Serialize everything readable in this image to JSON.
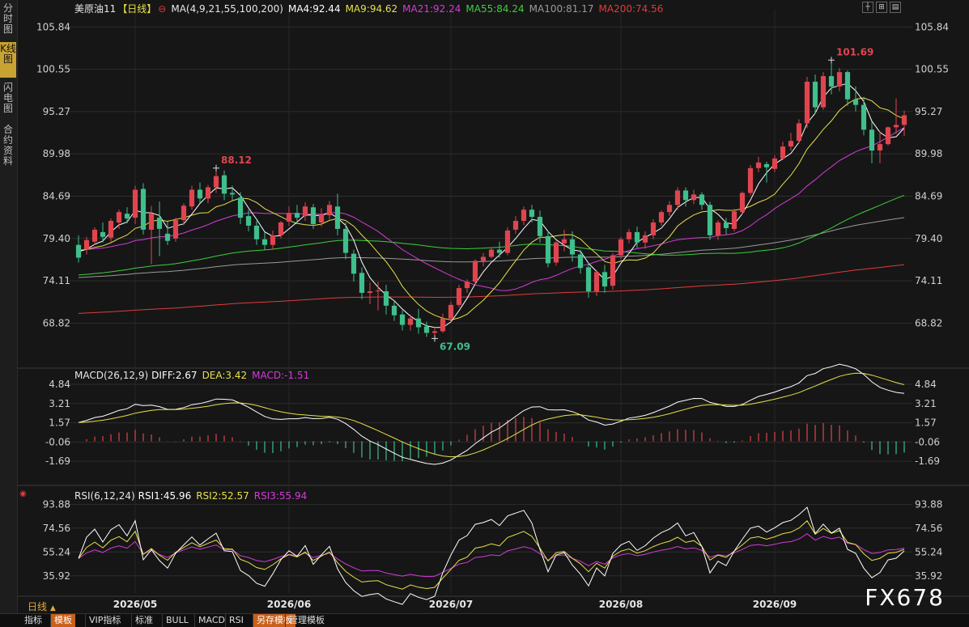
{
  "left_tabs": [
    {
      "label": "分时图",
      "active": false
    },
    {
      "label": "K线图",
      "active": true
    },
    {
      "label": "闪电图",
      "active": false
    },
    {
      "label": "合约资料",
      "active": false
    }
  ],
  "main_legend": {
    "symbol": "美原油11",
    "period": "【日线】",
    "ma_params": "MA(4,9,21,55,100,200)",
    "ma4": "MA4:92.44",
    "ma9": "MA9:94.62",
    "ma21": "MA21:92.24",
    "ma55": "MA55:84.24",
    "ma100": "MA100:81.17",
    "ma200": "MA200:74.56"
  },
  "macd_legend": {
    "title": "MACD(26,12,9)",
    "diff": "DIFF:2.67",
    "dea": "DEA:3.42",
    "macd": "MACD:-1.51"
  },
  "rsi_legend": {
    "title": "RSI(6,12,24)",
    "rsi1": "RSI1:45.96",
    "rsi2": "RSI2:52.57",
    "rsi3": "RSI3:55.94"
  },
  "colors": {
    "up": "#e0454f",
    "down": "#3fbf8c",
    "ma4": "#ffffff",
    "ma9": "#e6e04a",
    "ma21": "#d43bd9",
    "ma55": "#3ccf3c",
    "ma100": "#9a9a9a",
    "ma200": "#e23b3b",
    "grid": "#2e2e2e"
  },
  "annotations": {
    "high": "88.12",
    "peak": "101.69",
    "low": "67.09"
  },
  "bottom_period": "日线",
  "bottom_tabs": [
    {
      "label": "指标",
      "hl": false
    },
    {
      "label": "模板",
      "hl": true
    },
    {
      "label": "VIP指标",
      "hl": false
    },
    {
      "label": "标准",
      "hl": false
    },
    {
      "label": "BULL",
      "hl": false
    },
    {
      "label": "MACD",
      "hl": false
    },
    {
      "label": "RSI",
      "hl": false
    },
    {
      "label": "另存模板",
      "hl": true
    },
    {
      "label": "管理模板",
      "hl": false
    }
  ],
  "watermark": "FX678",
  "chart_data": {
    "type": "candlestick",
    "price_axis": {
      "ticks": [
        "105.84",
        "100.55",
        "95.27",
        "89.98",
        "84.69",
        "79.40",
        "74.11",
        "68.82"
      ],
      "range": [
        63.5,
        108
      ]
    },
    "macd_axis": {
      "ticks": [
        "4.84",
        "3.21",
        "1.57",
        "-0.06",
        "-1.69"
      ],
      "range": [
        -3.2,
        5.6
      ]
    },
    "rsi_axis": {
      "ticks": [
        "93.88",
        "74.56",
        "55.24",
        "35.92"
      ],
      "range": [
        22,
        100
      ]
    },
    "x_labels": [
      "2026/05",
      "2026/06",
      "2026/07",
      "2026/08",
      "2026/09"
    ],
    "x_label_index": [
      7,
      26,
      46,
      67,
      86
    ],
    "candles": [
      [
        78.6,
        79.8,
        77.0,
        76.4
      ],
      [
        78.0,
        79.6,
        79.2,
        77.4
      ],
      [
        79.0,
        80.8,
        80.5,
        78.6
      ],
      [
        80.2,
        81.4,
        79.6,
        78.9
      ],
      [
        79.5,
        81.9,
        81.6,
        79.0
      ],
      [
        81.4,
        83.0,
        82.7,
        80.6
      ],
      [
        82.5,
        83.3,
        81.9,
        81.3
      ],
      [
        82.0,
        86.0,
        85.5,
        81.2
      ],
      [
        85.6,
        86.3,
        80.5,
        79.9
      ],
      [
        80.5,
        83.5,
        82.5,
        76.2
      ],
      [
        82.0,
        84.0,
        80.6,
        77.2
      ],
      [
        80.0,
        81.5,
        79.1,
        78.6
      ],
      [
        79.4,
        82.0,
        81.7,
        79.0
      ],
      [
        81.7,
        83.8,
        83.5,
        81.1
      ],
      [
        83.4,
        86.0,
        85.5,
        83.0
      ],
      [
        85.5,
        86.4,
        84.4,
        83.8
      ],
      [
        84.4,
        86.1,
        85.8,
        83.8
      ],
      [
        85.8,
        88.2,
        87.2,
        85.1
      ],
      [
        87.3,
        87.9,
        85.0,
        84.2
      ],
      [
        85.1,
        86.0,
        84.9,
        84.2
      ],
      [
        84.5,
        85.2,
        82.0,
        81.2
      ],
      [
        82.2,
        83.0,
        81.0,
        80.3
      ],
      [
        81.0,
        81.6,
        79.3,
        78.6
      ],
      [
        79.3,
        80.2,
        78.6,
        78.0
      ],
      [
        78.6,
        80.4,
        79.8,
        78.1
      ],
      [
        79.8,
        81.6,
        81.4,
        79.4
      ],
      [
        81.5,
        83.4,
        82.6,
        81.0
      ],
      [
        82.6,
        83.6,
        82.0,
        81.2
      ],
      [
        82.2,
        83.9,
        83.4,
        81.6
      ],
      [
        83.3,
        83.7,
        81.2,
        80.6
      ],
      [
        81.4,
        83.2,
        82.4,
        80.9
      ],
      [
        82.3,
        84.1,
        83.6,
        81.8
      ],
      [
        83.4,
        85.0,
        80.6,
        79.8
      ],
      [
        80.6,
        81.4,
        77.6,
        76.8
      ],
      [
        77.5,
        78.0,
        75.0,
        74.0
      ],
      [
        75.1,
        75.8,
        72.6,
        71.8
      ],
      [
        72.6,
        73.9,
        72.8,
        71.2
      ],
      [
        72.8,
        74.0,
        72.9,
        70.4
      ],
      [
        72.8,
        73.6,
        71.0,
        69.9
      ],
      [
        71.0,
        71.6,
        69.8,
        69.1
      ],
      [
        69.9,
        70.4,
        68.6,
        67.9
      ],
      [
        68.6,
        69.9,
        69.4,
        67.9
      ],
      [
        69.4,
        70.6,
        68.3,
        67.5
      ],
      [
        68.4,
        69.0,
        67.6,
        67.1
      ],
      [
        67.6,
        68.3,
        67.8,
        66.9
      ],
      [
        67.8,
        70.0,
        69.4,
        67.6
      ],
      [
        69.4,
        71.5,
        71.1,
        69.0
      ],
      [
        71.1,
        73.6,
        73.2,
        70.8
      ],
      [
        73.2,
        74.3,
        74.0,
        72.6
      ],
      [
        74.0,
        76.8,
        76.6,
        73.5
      ],
      [
        76.6,
        77.6,
        77.1,
        75.9
      ],
      [
        77.1,
        78.3,
        78.0,
        76.9
      ],
      [
        78.0,
        79.0,
        77.6,
        77.0
      ],
      [
        77.6,
        80.8,
        80.4,
        77.3
      ],
      [
        80.5,
        82.2,
        81.6,
        80.0
      ],
      [
        81.6,
        83.4,
        83.0,
        81.1
      ],
      [
        83.0,
        83.6,
        82.1,
        81.4
      ],
      [
        82.1,
        82.9,
        79.7,
        78.9
      ],
      [
        79.7,
        80.3,
        76.3,
        75.8
      ],
      [
        76.4,
        79.1,
        78.9,
        76.0
      ],
      [
        78.8,
        80.5,
        79.3,
        77.8
      ],
      [
        79.3,
        80.3,
        77.4,
        76.5
      ],
      [
        77.4,
        78.0,
        75.7,
        75.0
      ],
      [
        75.8,
        76.4,
        72.8,
        72.0
      ],
      [
        72.8,
        75.4,
        75.2,
        72.2
      ],
      [
        75.2,
        76.1,
        73.4,
        72.6
      ],
      [
        73.5,
        77.6,
        77.3,
        73.0
      ],
      [
        77.3,
        79.6,
        79.3,
        76.8
      ],
      [
        79.3,
        80.6,
        80.2,
        78.8
      ],
      [
        80.2,
        80.9,
        78.9,
        78.2
      ],
      [
        78.9,
        80.3,
        79.8,
        78.1
      ],
      [
        79.8,
        81.8,
        81.4,
        79.3
      ],
      [
        81.4,
        82.9,
        82.7,
        81.0
      ],
      [
        82.7,
        84.1,
        83.6,
        82.2
      ],
      [
        83.6,
        85.8,
        85.4,
        83.0
      ],
      [
        85.4,
        85.8,
        84.2,
        83.4
      ],
      [
        84.2,
        85.5,
        84.9,
        83.7
      ],
      [
        84.9,
        85.2,
        83.6,
        83.0
      ],
      [
        83.6,
        84.0,
        79.8,
        79.2
      ],
      [
        79.8,
        81.7,
        81.4,
        79.2
      ],
      [
        81.4,
        82.0,
        80.7,
        79.9
      ],
      [
        80.6,
        83.1,
        82.8,
        80.3
      ],
      [
        82.7,
        85.3,
        85.1,
        82.4
      ],
      [
        85.1,
        88.6,
        88.2,
        84.8
      ],
      [
        88.2,
        89.6,
        88.9,
        87.7
      ],
      [
        88.7,
        89.0,
        88.3,
        86.4
      ],
      [
        88.1,
        89.8,
        89.4,
        87.7
      ],
      [
        89.4,
        91.5,
        90.9,
        89.2
      ],
      [
        90.9,
        92.6,
        91.6,
        90.4
      ],
      [
        91.6,
        94.3,
        93.8,
        91.3
      ],
      [
        93.8,
        99.6,
        99.0,
        93.2
      ],
      [
        99.0,
        99.9,
        95.8,
        95.0
      ],
      [
        95.8,
        100.2,
        99.7,
        95.5
      ],
      [
        99.7,
        101.7,
        98.4,
        97.4
      ],
      [
        98.4,
        100.7,
        100.2,
        97.8
      ],
      [
        100.2,
        100.4,
        96.8,
        96.0
      ],
      [
        96.8,
        98.4,
        96.1,
        95.3
      ],
      [
        96.1,
        97.1,
        93.0,
        92.3
      ],
      [
        93.0,
        94.0,
        90.4,
        88.8
      ],
      [
        90.4,
        92.8,
        91.2,
        88.8
      ],
      [
        91.2,
        93.4,
        93.3,
        91.0
      ],
      [
        93.3,
        96.9,
        93.6,
        92.5
      ],
      [
        93.6,
        95.4,
        94.8,
        92.2
      ]
    ],
    "ma_series": [
      {
        "name": "MA4"
      },
      {
        "name": "MA9"
      },
      {
        "name": "MA21"
      },
      {
        "name": "MA55"
      },
      {
        "name": "MA100"
      },
      {
        "name": "MA200"
      }
    ]
  }
}
